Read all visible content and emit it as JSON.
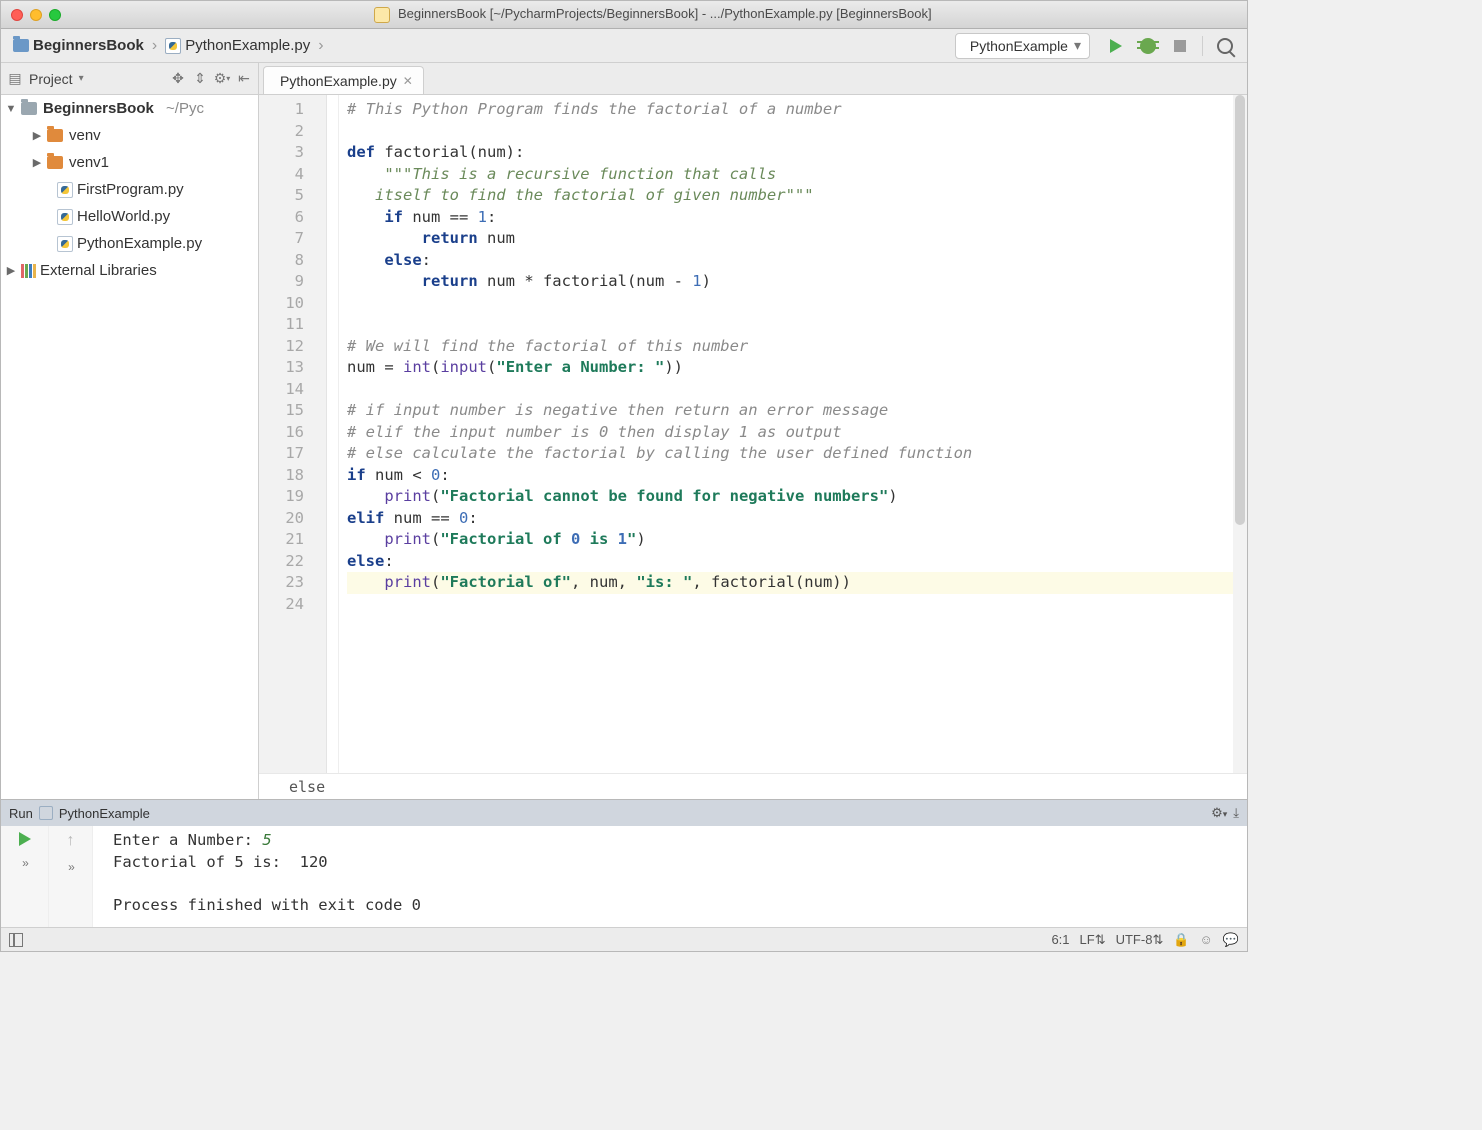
{
  "titlebar": {
    "title": "BeginnersBook [~/PycharmProjects/BeginnersBook] - .../PythonExample.py [BeginnersBook]"
  },
  "breadcrumb": {
    "root": "BeginnersBook",
    "file": "PythonExample.py"
  },
  "run_config": {
    "name": "PythonExample"
  },
  "toolrow": {
    "project_label": "Project"
  },
  "tab": {
    "name": "PythonExample.py"
  },
  "tree": {
    "root": {
      "name": "BeginnersBook",
      "path": "~/Pyc"
    },
    "children": [
      {
        "name": "venv",
        "type": "folder"
      },
      {
        "name": "venv1",
        "type": "folder"
      },
      {
        "name": "FirstProgram.py",
        "type": "py"
      },
      {
        "name": "HelloWorld.py",
        "type": "py"
      },
      {
        "name": "PythonExample.py",
        "type": "py"
      }
    ],
    "external": "External Libraries"
  },
  "code": {
    "lines": [
      "# This Python Program finds the factorial of a number",
      "",
      "def factorial(num):",
      "    \"\"\"This is a recursive function that calls",
      "   itself to find the factorial of given number\"\"\"",
      "    if num == 1:",
      "        return num",
      "    else:",
      "        return num * factorial(num - 1)",
      "",
      "",
      "# We will find the factorial of this number",
      "num = int(input(\"Enter a Number: \"))",
      "",
      "# if input number is negative then return an error message",
      "# elif the input number is 0 then display 1 as output",
      "# else calculate the factorial by calling the user defined function",
      "if num < 0:",
      "    print(\"Factorial cannot be found for negative numbers\")",
      "elif num == 0:",
      "    print(\"Factorial of 0 is 1\")",
      "else:",
      "    print(\"Factorial of\", num, \"is: \", factorial(num))",
      ""
    ],
    "context": "else"
  },
  "run_panel": {
    "label_run": "Run",
    "config": "PythonExample",
    "output": {
      "line1_prompt": "Enter a Number: ",
      "line1_value": "5",
      "line2": "Factorial of 5 is:  120",
      "line4": "Process finished with exit code 0"
    }
  },
  "status": {
    "cursor": "6:1",
    "line_sep": "LF",
    "encoding": "UTF-8"
  }
}
